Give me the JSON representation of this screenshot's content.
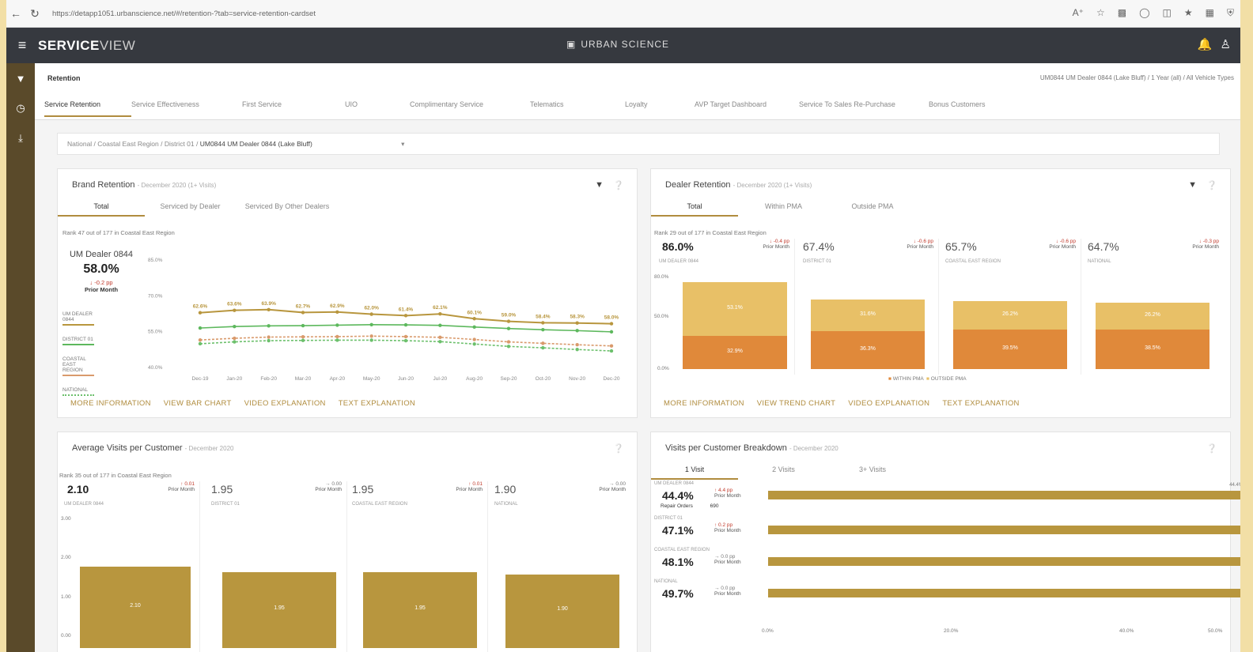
{
  "browser": {
    "url": "https://detapp1051.urbanscience.net/#/retention-?tab=service-retention-cardset"
  },
  "app": {
    "brand_bold": "SERVICE",
    "brand_light": "VIEW",
    "center_logo": "URBAN SCIENCE"
  },
  "page": {
    "title": "Retention",
    "filters_summary": "UM0844 UM Dealer 0844 (Lake Bluff) / 1 Year (all) / All Vehicle Types"
  },
  "tabs": [
    "Service Retention",
    "Service Effectiveness",
    "First Service",
    "UIO",
    "Complimentary Service",
    "Telematics",
    "Loyalty",
    "AVP Target Dashboard",
    "Service To Sales Re-Purchase",
    "Bonus Customers"
  ],
  "breadcrumb": {
    "path": "National / Coastal East Region / District 01 /",
    "selected": "UM0844 UM Dealer 0844 (Lake Bluff)"
  },
  "brand": {
    "title": "Brand Retention",
    "subtitle": "- December 2020 (1+ Visits)",
    "tabs": [
      "Total",
      "Serviced by Dealer",
      "Serviced By Other Dealers"
    ],
    "rank": "Rank 47 out of 177 in Coastal East Region",
    "dealer": "UM Dealer 0844",
    "value": "58.0%",
    "delta": "↓ -0.2 pp",
    "delta_label": "Prior Month",
    "legend": [
      "UM DEALER 0844",
      "DISTRICT 01",
      "COASTAL EAST REGION",
      "NATIONAL"
    ],
    "links": [
      "MORE INFORMATION",
      "VIEW BAR CHART",
      "VIDEO EXPLANATION",
      "TEXT EXPLANATION"
    ]
  },
  "dealer": {
    "title": "Dealer Retention",
    "subtitle": "- December 2020 (1+ Visits)",
    "tabs": [
      "Total",
      "Within PMA",
      "Outside PMA"
    ],
    "rank": "Rank 29 out of 177 in Coastal East Region",
    "cols": [
      {
        "value": "86.0%",
        "delta": "↓ -0.4 pp",
        "label": "UM DEALER 0844",
        "top": "53.1%",
        "bottom": "32.9%",
        "bold": true
      },
      {
        "value": "67.4%",
        "delta": "↓ -0.6 pp",
        "label": "DISTRICT 01",
        "top": "31.6%",
        "bottom": "36.3%",
        "bold": false
      },
      {
        "value": "65.7%",
        "delta": "↓ -0.6 pp",
        "label": "COASTAL EAST REGION",
        "top": "26.2%",
        "bottom": "39.5%",
        "bold": false
      },
      {
        "value": "64.7%",
        "delta": "↓ -0.3 pp",
        "label": "NATIONAL",
        "top": "26.2%",
        "bottom": "38.5%",
        "bold": false
      }
    ],
    "axis": [
      "80.0%",
      "50.0%",
      "0.0%"
    ],
    "legend": [
      "WITHIN PMA",
      "OUTSIDE PMA"
    ],
    "links": [
      "MORE INFORMATION",
      "VIEW TREND CHART",
      "VIDEO EXPLANATION",
      "TEXT EXPLANATION"
    ]
  },
  "visits": {
    "title": "Average Visits per Customer",
    "subtitle": "- December 2020",
    "rank": "Rank 35 out of 177 in Coastal East Region",
    "cols": [
      {
        "value": "2.10",
        "delta": "↑ 0.01",
        "label": "UM DEALER 0844",
        "bar": "2.10",
        "bold": true
      },
      {
        "value": "1.95",
        "delta": "→ 0.00",
        "label": "DISTRICT 01",
        "bar": "1.95",
        "bold": false
      },
      {
        "value": "1.95",
        "delta": "↑ 0.01",
        "label": "COASTAL EAST REGION",
        "bar": "1.95",
        "bold": false
      },
      {
        "value": "1.90",
        "delta": "→ 0.00",
        "label": "NATIONAL",
        "bar": "1.90",
        "bold": false
      }
    ],
    "delta_label": "Prior Month",
    "axis": [
      "3.00",
      "2.00",
      "1.00",
      "0.00"
    ]
  },
  "breakdown": {
    "title": "Visits per Customer Breakdown",
    "subtitle": "- December 2020",
    "tabs": [
      "1 Visit",
      "2 Visits",
      "3+ Visits"
    ],
    "rows": [
      {
        "label": "UM DEALER 0844",
        "value": "44.4%",
        "delta": "↑ 4.4 pp",
        "extra": "Repair Orders",
        "extra_val": "690",
        "bar": "44.4%"
      },
      {
        "label": "DISTRICT 01",
        "value": "47.1%",
        "delta": "↑ 0.2 pp",
        "extra": "",
        "extra_val": "",
        "bar": "47.1%"
      },
      {
        "label": "COASTAL EAST REGION",
        "value": "48.1%",
        "delta": "→ 0.0 pp",
        "extra": "",
        "extra_val": "",
        "bar": "48.1%"
      },
      {
        "label": "NATIONAL",
        "value": "49.7%",
        "delta": "→ 0.0 pp",
        "extra": "",
        "extra_val": "",
        "bar": "49.7%"
      }
    ],
    "delta_label": "Prior Month",
    "axis": [
      "0.0%",
      "20.0%",
      "40.0%",
      "50.0%"
    ]
  },
  "chart_data": {
    "type": "line",
    "categories": [
      "Dec-19",
      "Jan-20",
      "Feb-20",
      "Mar-20",
      "Apr-20",
      "May-20",
      "Jun-20",
      "Jul-20",
      "Aug-20",
      "Sep-20",
      "Oct-20",
      "Nov-20",
      "Dec-20"
    ],
    "ylabels": [
      "85.0%",
      "70.0%",
      "55.0%",
      "40.0%"
    ],
    "ylim": [
      40,
      85
    ],
    "series": [
      {
        "name": "UM DEALER 0844",
        "color": "#b8963e",
        "values": [
          62.6,
          63.6,
          63.9,
          62.7,
          62.9,
          62.0,
          61.4,
          62.1,
          60.1,
          59.0,
          58.4,
          58.3,
          58.0
        ],
        "labels": [
          "62.6%",
          "63.6%",
          "63.9%",
          "62.7%",
          "62.9%",
          "62.0%",
          "61.4%",
          "62.1%",
          "60.1%",
          "59.0%",
          "58.4%",
          "58.3%",
          "58.0%"
        ]
      },
      {
        "name": "DISTRICT 01",
        "color": "#5db85d",
        "values": [
          56.2,
          56.8,
          57.1,
          57.2,
          57.4,
          57.6,
          57.5,
          57.3,
          56.6,
          56.0,
          55.5,
          55.1,
          54.6
        ]
      },
      {
        "name": "COASTAL EAST REGION",
        "color": "#d99a6c",
        "values": [
          51.2,
          51.9,
          52.4,
          52.5,
          52.6,
          52.8,
          52.6,
          52.3,
          51.4,
          50.4,
          49.8,
          49.2,
          48.7
        ]
      },
      {
        "name": "NATIONAL",
        "color": "#6cc06c",
        "values": [
          49.6,
          50.4,
          50.9,
          51.0,
          51.1,
          51.1,
          50.9,
          50.5,
          49.5,
          48.5,
          47.9,
          47.2,
          46.6
        ]
      }
    ]
  }
}
